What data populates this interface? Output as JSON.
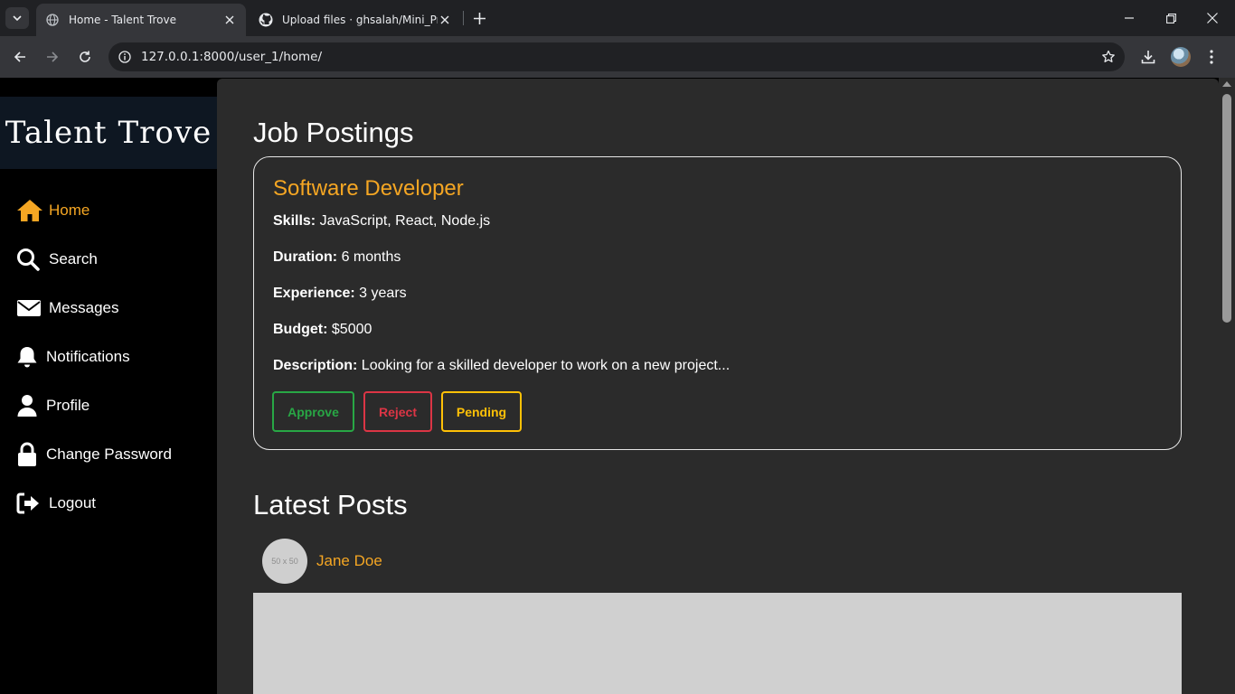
{
  "browser": {
    "tabs": [
      {
        "title": "Home - Talent Trove",
        "active": true,
        "icon": "globe-icon"
      },
      {
        "title": "Upload files · ghsalah/Mini_Proj",
        "active": false,
        "icon": "github-icon"
      }
    ],
    "url": "127.0.0.1:8000/user_1/home/"
  },
  "sidebar": {
    "logo": "Talent Trove",
    "items": [
      {
        "label": "Home",
        "icon": "home-icon",
        "active": true
      },
      {
        "label": "Search",
        "icon": "search-icon",
        "active": false
      },
      {
        "label": "Messages",
        "icon": "envelope-icon",
        "active": false
      },
      {
        "label": "Notifications",
        "icon": "bell-icon",
        "active": false
      },
      {
        "label": "Profile",
        "icon": "user-icon",
        "active": false
      },
      {
        "label": "Change Password",
        "icon": "lock-icon",
        "active": false
      },
      {
        "label": "Logout",
        "icon": "logout-icon",
        "active": false
      }
    ]
  },
  "main": {
    "job_heading": "Job Postings",
    "job": {
      "title": "Software Developer",
      "fields": [
        {
          "label": "Skills:",
          "value": "JavaScript, React, Node.js"
        },
        {
          "label": "Duration:",
          "value": "6 months"
        },
        {
          "label": "Experience:",
          "value": "3 years"
        },
        {
          "label": "Budget:",
          "value": "$5000"
        },
        {
          "label": "Description:",
          "value": "Looking for a skilled developer to work on a new project..."
        }
      ],
      "actions": {
        "approve": "Approve",
        "reject": "Reject",
        "pending": "Pending"
      }
    },
    "posts_heading": "Latest Posts",
    "post": {
      "avatar_placeholder": "50 x 50",
      "author": "Jane Doe"
    }
  },
  "colors": {
    "accent": "#f5a623",
    "approve": "#28a745",
    "reject": "#dc3545",
    "pending": "#ffc107"
  }
}
